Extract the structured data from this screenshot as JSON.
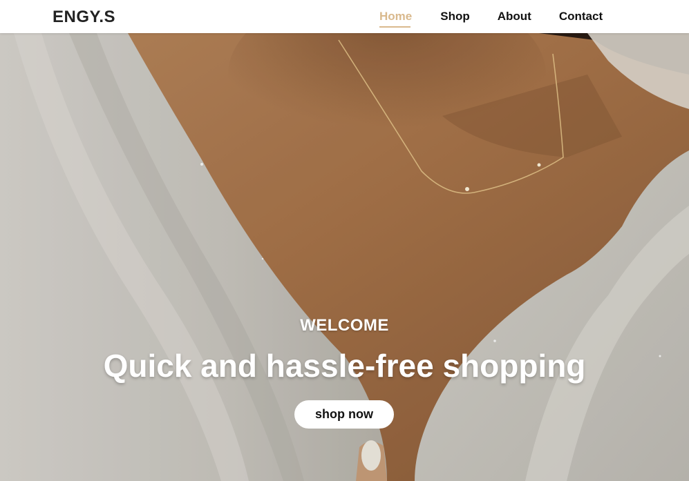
{
  "brand": {
    "logo_text": "ENGY.S"
  },
  "nav": {
    "items": [
      {
        "label": "Home",
        "active": true
      },
      {
        "label": "Shop",
        "active": false
      },
      {
        "label": "About",
        "active": false
      },
      {
        "label": "Contact",
        "active": false
      }
    ]
  },
  "hero": {
    "kicker": "WELCOME",
    "headline": "Quick and hassle-free shopping",
    "cta_label": "shop now",
    "image_description_icon": "photo-woman-necklace-white-shirt"
  },
  "colors": {
    "accent": "#d9b98d",
    "text_dark": "#111111",
    "header_bg": "#ffffff"
  }
}
